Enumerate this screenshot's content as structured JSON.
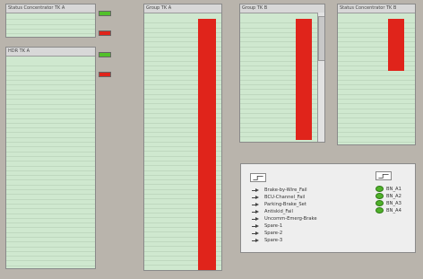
{
  "panels": {
    "status_concentrator_a": {
      "title": "Status Concentrator TK A"
    },
    "hdr_tk_a": {
      "title": "HDR TK A"
    },
    "center_1": {
      "title": "Group TK A",
      "col": ""
    },
    "center_2": {
      "title": "Group TK B"
    },
    "status_concentrator_b": {
      "title": "Status Concentrator TK B"
    }
  },
  "legend": {
    "items": [
      "Brake-by-Wire_Fail",
      "BCU-Channel_Fail",
      "Parking-Brake_Set",
      "Antiskid_Fail",
      "Uncomm-Emerg-Brake",
      "Spare-1",
      "Spare-2",
      "Spare-3"
    ],
    "bn_items": [
      "BN_A1",
      "BN_A2",
      "BN_A3",
      "BN_A4"
    ]
  },
  "colors": {
    "background": "#b9b4ac",
    "panel_green": "#cfe8cf",
    "alarm_red": "#e0241b",
    "status_green": "#52c02a"
  }
}
